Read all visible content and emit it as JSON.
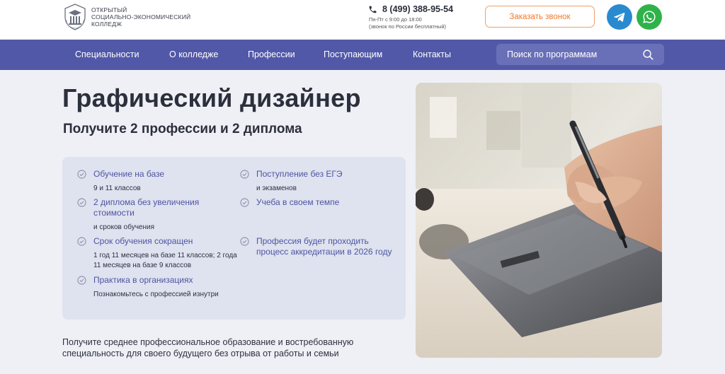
{
  "logo": {
    "lines": [
      "Открытый",
      "социально-экономический",
      "колледж"
    ],
    "icon": "college-emblem-icon"
  },
  "contacts": {
    "phone": "8 (499) 388-95-54",
    "hours": "Пн-Пт с 9:00 до 18:00",
    "note": "(звонок по России бесплатный)",
    "call_button": "Заказать звонок"
  },
  "social": [
    {
      "icon": "telegram-icon",
      "color": "#2a8ad0"
    },
    {
      "icon": "whatsapp-icon",
      "color": "#2fb24a"
    }
  ],
  "nav": {
    "items": [
      "Специальности",
      "О колледже",
      "Профессии",
      "Поступающим",
      "Контакты"
    ],
    "search_placeholder": "Поиск по программам"
  },
  "hero": {
    "title": "Графический дизайнер",
    "subtitle": "Получите 2 профессии и 2 диплома",
    "features_left": [
      {
        "title": "Обучение на базе",
        "desc": "9 и 11 классов"
      },
      {
        "title": "2 диплома без увеличения стоимости",
        "desc": "и сроков обучения"
      },
      {
        "title": "Срок обучения сокращен",
        "desc": "1 год 11 месяцев на базе 11 классов; 2 года 11 месяцев на базе 9 классов"
      },
      {
        "title": "Практика в организациях",
        "desc": "Познакомьтесь с профессией изнутри"
      }
    ],
    "features_right": [
      {
        "title": "Поступление без ЕГЭ",
        "desc": "и экзаменов"
      },
      {
        "title": "Учеба в своем темпе",
        "desc": ""
      },
      {
        "title": "Профессия будет проходить процесс аккредитации в 2026 году",
        "desc": ""
      }
    ],
    "description": "Получите среднее профессиональное образование и востребованную специальность для своего будущего без отрыва от работы и семьи"
  },
  "colors": {
    "nav": "#5158a8",
    "accent_orange": "#f07a2e",
    "feature_title": "#4d55a2",
    "feature_box": "#dfe2ef",
    "page_bg": "#eef0f6"
  }
}
